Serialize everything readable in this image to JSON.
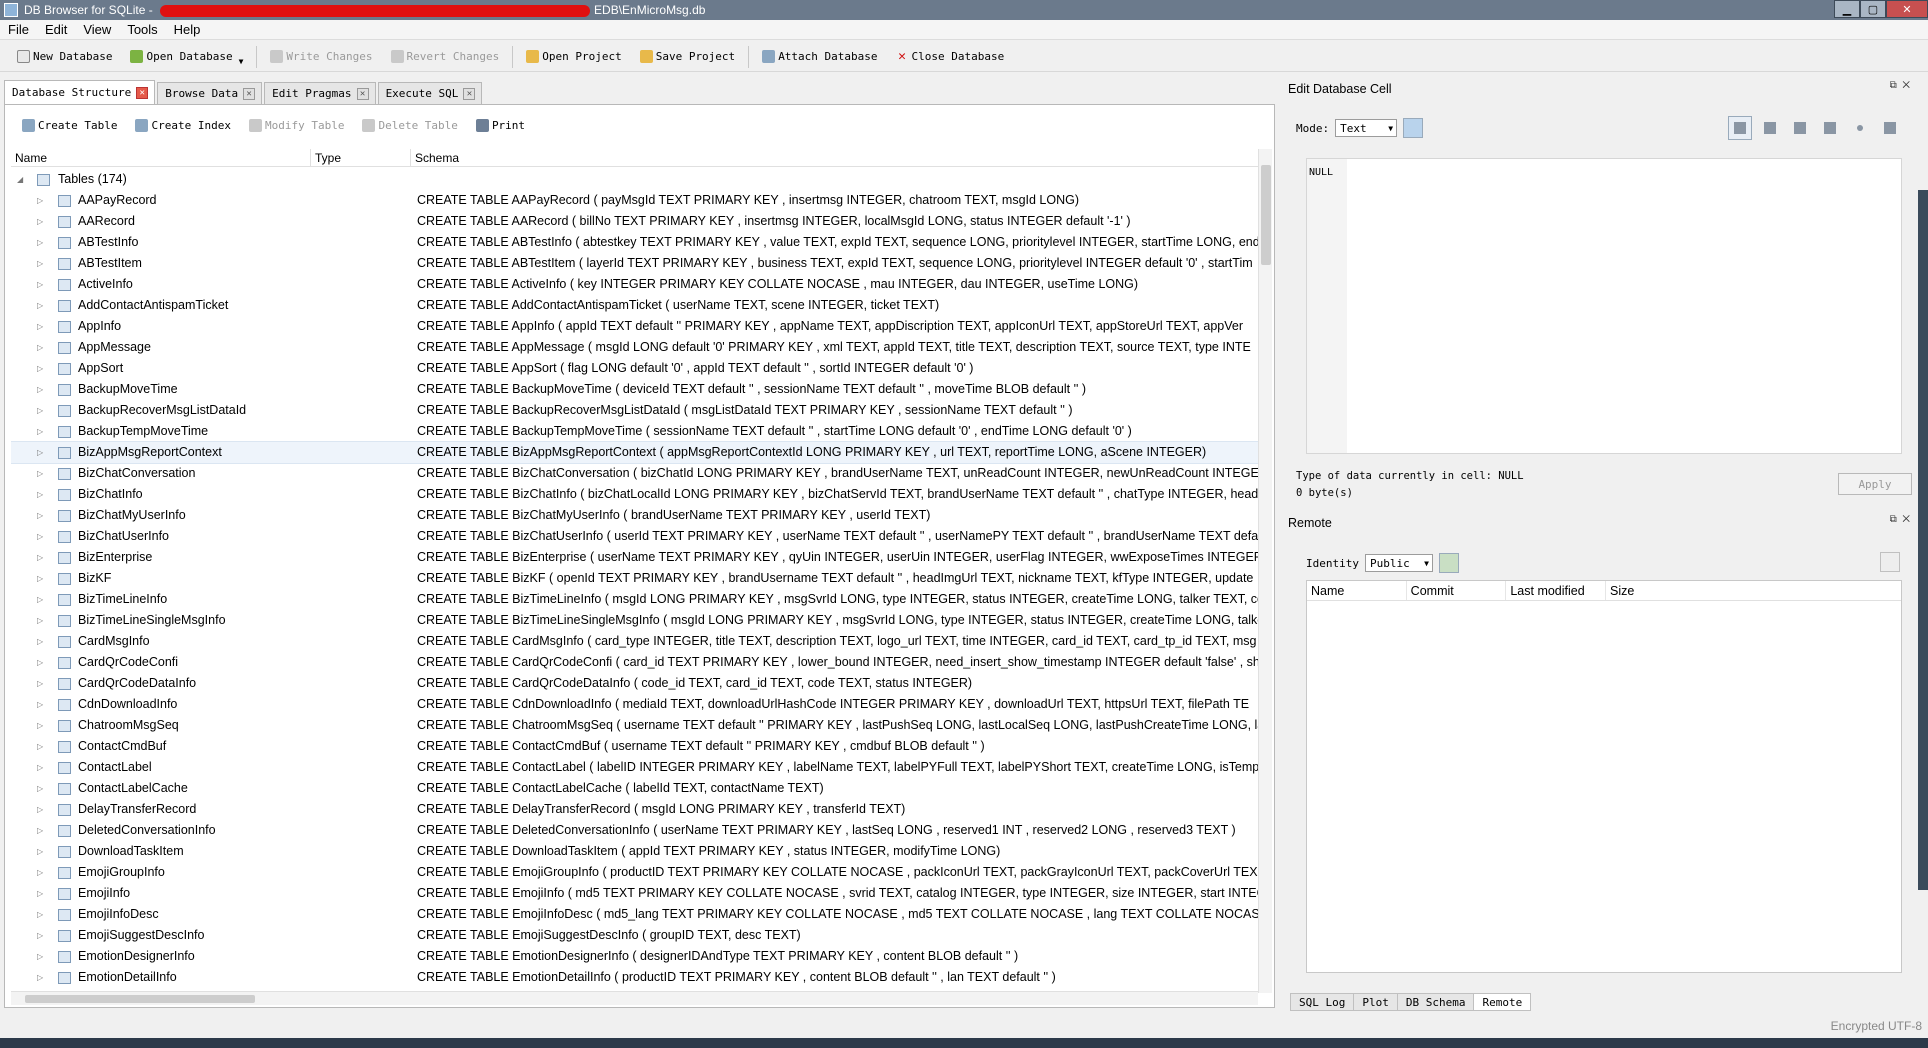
{
  "window": {
    "title_prefix": "DB Browser for SQLite - ",
    "title_suffix": "EDB\\EnMicroMsg.db",
    "min": "▁",
    "max": "▢",
    "close": "✕"
  },
  "menu": [
    "File",
    "Edit",
    "View",
    "Tools",
    "Help"
  ],
  "toolbar": {
    "new_database": "New Database",
    "open_database": "Open Database",
    "write_changes": "Write Changes",
    "revert_changes": "Revert Changes",
    "open_project": "Open Project",
    "save_project": "Save Project",
    "attach_database": "Attach Database",
    "close_database": "Close Database"
  },
  "tabs": [
    "Database Structure",
    "Browse Data",
    "Edit Pragmas",
    "Execute SQL"
  ],
  "structure_toolbar": {
    "create_table": "Create Table",
    "create_index": "Create Index",
    "modify_table": "Modify Table",
    "delete_table": "Delete Table",
    "print": "Print"
  },
  "tree": {
    "columns": [
      "Name",
      "Type",
      "Schema"
    ],
    "group_label": "Tables (174)",
    "rows": [
      {
        "name": "AAPayRecord",
        "schema": "CREATE TABLE AAPayRecord ( payMsgId TEXT PRIMARY KEY , insertmsg INTEGER, chatroom TEXT, msgId LONG)"
      },
      {
        "name": "AARecord",
        "schema": "CREATE TABLE AARecord ( billNo TEXT PRIMARY KEY , insertmsg INTEGER, localMsgId LONG, status INTEGER default '-1' )"
      },
      {
        "name": "ABTestInfo",
        "schema": "CREATE TABLE ABTestInfo ( abtestkey TEXT PRIMARY KEY , value TEXT, expId TEXT, sequence LONG, prioritylevel INTEGER, startTime LONG, end"
      },
      {
        "name": "ABTestItem",
        "schema": "CREATE TABLE ABTestItem ( layerId TEXT PRIMARY KEY , business TEXT, expId TEXT, sequence LONG, prioritylevel INTEGER default '0' , startTim"
      },
      {
        "name": "ActiveInfo",
        "schema": "CREATE TABLE ActiveInfo ( key INTEGER PRIMARY KEY COLLATE NOCASE , mau INTEGER, dau INTEGER, useTime LONG)"
      },
      {
        "name": "AddContactAntispamTicket",
        "schema": "CREATE TABLE AddContactAntispamTicket ( userName TEXT, scene INTEGER, ticket TEXT)"
      },
      {
        "name": "AppInfo",
        "schema": "CREATE TABLE AppInfo ( appId TEXT default '' PRIMARY KEY , appName TEXT, appDiscription TEXT, appIconUrl TEXT, appStoreUrl TEXT, appVer"
      },
      {
        "name": "AppMessage",
        "schema": "CREATE TABLE AppMessage ( msgId LONG default '0' PRIMARY KEY , xml TEXT, appId TEXT, title TEXT, description TEXT, source TEXT, type INTE"
      },
      {
        "name": "AppSort",
        "schema": "CREATE TABLE AppSort ( flag LONG default '0' , appId TEXT default '' , sortId INTEGER default '0' )"
      },
      {
        "name": "BackupMoveTime",
        "schema": "CREATE TABLE BackupMoveTime ( deviceId TEXT default '' , sessionName TEXT default '' , moveTime BLOB default '' )"
      },
      {
        "name": "BackupRecoverMsgListDataId",
        "schema": "CREATE TABLE BackupRecoverMsgListDataId ( msgListDataId TEXT PRIMARY KEY , sessionName TEXT default '' )"
      },
      {
        "name": "BackupTempMoveTime",
        "schema": "CREATE TABLE BackupTempMoveTime ( sessionName TEXT default '' , startTime LONG default '0' , endTime LONG default '0' )"
      },
      {
        "name": "BizAppMsgReportContext",
        "schema": "CREATE TABLE BizAppMsgReportContext ( appMsgReportContextId LONG PRIMARY KEY , url TEXT, reportTime LONG, aScene INTEGER)"
      },
      {
        "name": "BizChatConversation",
        "schema": "CREATE TABLE BizChatConversation ( bizChatId LONG PRIMARY KEY , brandUserName TEXT, unReadCount INTEGER, newUnReadCount INTEGER"
      },
      {
        "name": "BizChatInfo",
        "schema": "CREATE TABLE BizChatInfo ( bizChatLocalId LONG PRIMARY KEY , bizChatServId TEXT, brandUserName TEXT default '' , chatType INTEGER, head"
      },
      {
        "name": "BizChatMyUserInfo",
        "schema": "CREATE TABLE BizChatMyUserInfo ( brandUserName TEXT PRIMARY KEY , userId TEXT)"
      },
      {
        "name": "BizChatUserInfo",
        "schema": "CREATE TABLE BizChatUserInfo ( userId TEXT PRIMARY KEY , userName TEXT default '' , userNamePY TEXT default '' , brandUserName TEXT defa"
      },
      {
        "name": "BizEnterprise",
        "schema": "CREATE TABLE BizEnterprise ( userName TEXT PRIMARY KEY , qyUin INTEGER, userUin INTEGER, userFlag INTEGER, wwExposeTimes INTEGER, w"
      },
      {
        "name": "BizKF",
        "schema": "CREATE TABLE BizKF ( openId TEXT PRIMARY KEY , brandUsername TEXT default '' , headImgUrl TEXT, nickname TEXT, kfType INTEGER, update"
      },
      {
        "name": "BizTimeLineInfo",
        "schema": "CREATE TABLE BizTimeLineInfo ( msgId LONG PRIMARY KEY , msgSvrId LONG, type INTEGER, status INTEGER, createTime LONG, talker TEXT, co"
      },
      {
        "name": "BizTimeLineSingleMsgInfo",
        "schema": "CREATE TABLE BizTimeLineSingleMsgInfo ( msgId LONG PRIMARY KEY , msgSvrId LONG, type INTEGER, status INTEGER, createTime LONG, talke"
      },
      {
        "name": "CardMsgInfo",
        "schema": "CREATE TABLE CardMsgInfo ( card_type INTEGER, title TEXT, description TEXT, logo_url TEXT, time INTEGER, card_id TEXT, card_tp_id TEXT, msg"
      },
      {
        "name": "CardQrCodeConfi",
        "schema": "CREATE TABLE CardQrCodeConfi ( card_id TEXT PRIMARY KEY , lower_bound INTEGER, need_insert_show_timestamp INTEGER default 'false' , sho"
      },
      {
        "name": "CardQrCodeDataInfo",
        "schema": "CREATE TABLE CardQrCodeDataInfo ( code_id TEXT, card_id TEXT, code TEXT, status INTEGER)"
      },
      {
        "name": "CdnDownloadInfo",
        "schema": "CREATE TABLE CdnDownloadInfo ( mediaId TEXT, downloadUrlHashCode INTEGER PRIMARY KEY , downloadUrl TEXT, httpsUrl TEXT, filePath TE"
      },
      {
        "name": "ChatroomMsgSeq",
        "schema": "CREATE TABLE ChatroomMsgSeq ( username TEXT default '' PRIMARY KEY , lastPushSeq LONG, lastLocalSeq LONG, lastPushCreateTime LONG, la"
      },
      {
        "name": "ContactCmdBuf",
        "schema": "CREATE TABLE ContactCmdBuf ( username TEXT default '' PRIMARY KEY , cmdbuf BLOB default '' )"
      },
      {
        "name": "ContactLabel",
        "schema": "CREATE TABLE ContactLabel ( labelID INTEGER PRIMARY KEY , labelName TEXT, labelPYFull TEXT, labelPYShort TEXT, createTime LONG, isTempo"
      },
      {
        "name": "ContactLabelCache",
        "schema": "CREATE TABLE ContactLabelCache ( labelId TEXT, contactName TEXT)"
      },
      {
        "name": "DelayTransferRecord",
        "schema": "CREATE TABLE DelayTransferRecord ( msgId LONG PRIMARY KEY , transferId TEXT)"
      },
      {
        "name": "DeletedConversationInfo",
        "schema": "CREATE TABLE DeletedConversationInfo ( userName TEXT PRIMARY KEY , lastSeq LONG , reserved1 INT , reserved2 LONG , reserved3 TEXT )"
      },
      {
        "name": "DownloadTaskItem",
        "schema": "CREATE TABLE DownloadTaskItem ( appId TEXT PRIMARY KEY , status INTEGER, modifyTime LONG)"
      },
      {
        "name": "EmojiGroupInfo",
        "schema": "CREATE TABLE EmojiGroupInfo ( productID TEXT PRIMARY KEY COLLATE NOCASE , packIconUrl TEXT, packGrayIconUrl TEXT, packCoverUrl TEX"
      },
      {
        "name": "EmojiInfo",
        "schema": "CREATE TABLE EmojiInfo ( md5 TEXT PRIMARY KEY COLLATE NOCASE , svrid TEXT, catalog INTEGER, type INTEGER, size INTEGER, start INTEGE"
      },
      {
        "name": "EmojiInfoDesc",
        "schema": "CREATE TABLE EmojiInfoDesc ( md5_lang TEXT PRIMARY KEY COLLATE NOCASE , md5 TEXT COLLATE NOCASE , lang TEXT COLLATE NOCASE , d"
      },
      {
        "name": "EmojiSuggestDescInfo",
        "schema": "CREATE TABLE EmojiSuggestDescInfo ( groupID TEXT, desc TEXT)"
      },
      {
        "name": "EmotionDesignerInfo",
        "schema": "CREATE TABLE EmotionDesignerInfo ( designerIDAndType TEXT PRIMARY KEY , content BLOB default '' )"
      },
      {
        "name": "EmotionDetailInfo",
        "schema": "CREATE TABLE EmotionDetailInfo ( productID TEXT PRIMARY KEY , content BLOB default '' , lan TEXT default '' )"
      }
    ]
  },
  "edit_cell": {
    "title": "Edit Database Cell",
    "mode_label": "Mode:",
    "mode_value": "Text",
    "cell_value": "NULL",
    "type_info": "Type of data currently in cell: NULL",
    "size_info": "0 byte(s)",
    "apply": "Apply"
  },
  "remote": {
    "title": "Remote",
    "identity_label": "Identity",
    "identity_value": "Public",
    "columns": [
      "Name",
      "Commit",
      "Last modified",
      "Size"
    ]
  },
  "dock_tabs": [
    "SQL Log",
    "Plot",
    "DB Schema",
    "Remote"
  ],
  "status": "Encrypted  UTF-8"
}
